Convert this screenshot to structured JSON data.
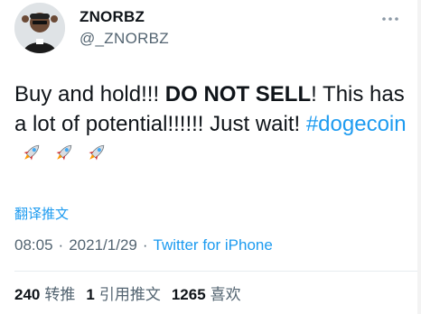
{
  "author": {
    "name": "ZNORBZ",
    "handle": "@_ZNORBZ",
    "avatar_icon": "avatar-image"
  },
  "more_icon": "more-dots-icon",
  "tweet": {
    "text_part1": "Buy and hold!!! ",
    "text_bold": "DO NOT SELL",
    "text_part2": "! This has a lot of potential!!!!!! Just wait! ",
    "hashtag": "#dogecoin",
    "rocket_icon": "rocket-emoji"
  },
  "translate_label": "翻译推文",
  "meta": {
    "time": "08:05",
    "separator": "·",
    "date": "2021/1/29",
    "client": "Twitter for iPhone"
  },
  "stats": {
    "retweets_count": "240",
    "retweets_label": "转推",
    "quotes_count": "1",
    "quotes_label": "引用推文",
    "likes_count": "1265",
    "likes_label": "喜欢"
  },
  "colors": {
    "link": "#1d9bf0",
    "secondary_text": "#536471",
    "primary_text": "#0f1419"
  }
}
